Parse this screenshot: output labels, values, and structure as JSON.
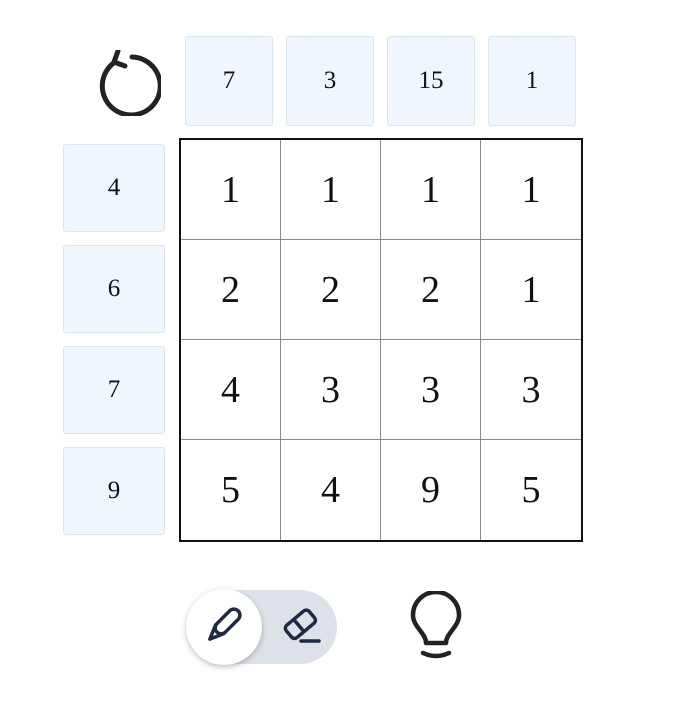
{
  "controls": {
    "reset_icon": "rotate-cw-icon",
    "pencil_icon": "pencil-icon",
    "eraser_icon": "eraser-icon",
    "hint_icon": "lightbulb-icon",
    "mode_selected": "pencil"
  },
  "column_clues": [
    "7",
    "3",
    "15",
    "1"
  ],
  "row_clues": [
    "4",
    "6",
    "7",
    "9"
  ],
  "grid": [
    [
      "1",
      "1",
      "1",
      "1"
    ],
    [
      "2",
      "2",
      "2",
      "1"
    ],
    [
      "4",
      "3",
      "3",
      "3"
    ],
    [
      "5",
      "4",
      "9",
      "5"
    ]
  ],
  "colors": {
    "clue_background": "#eff6fe",
    "icon_color": "#1e2a44",
    "toggle_track": "#dde1e8"
  }
}
